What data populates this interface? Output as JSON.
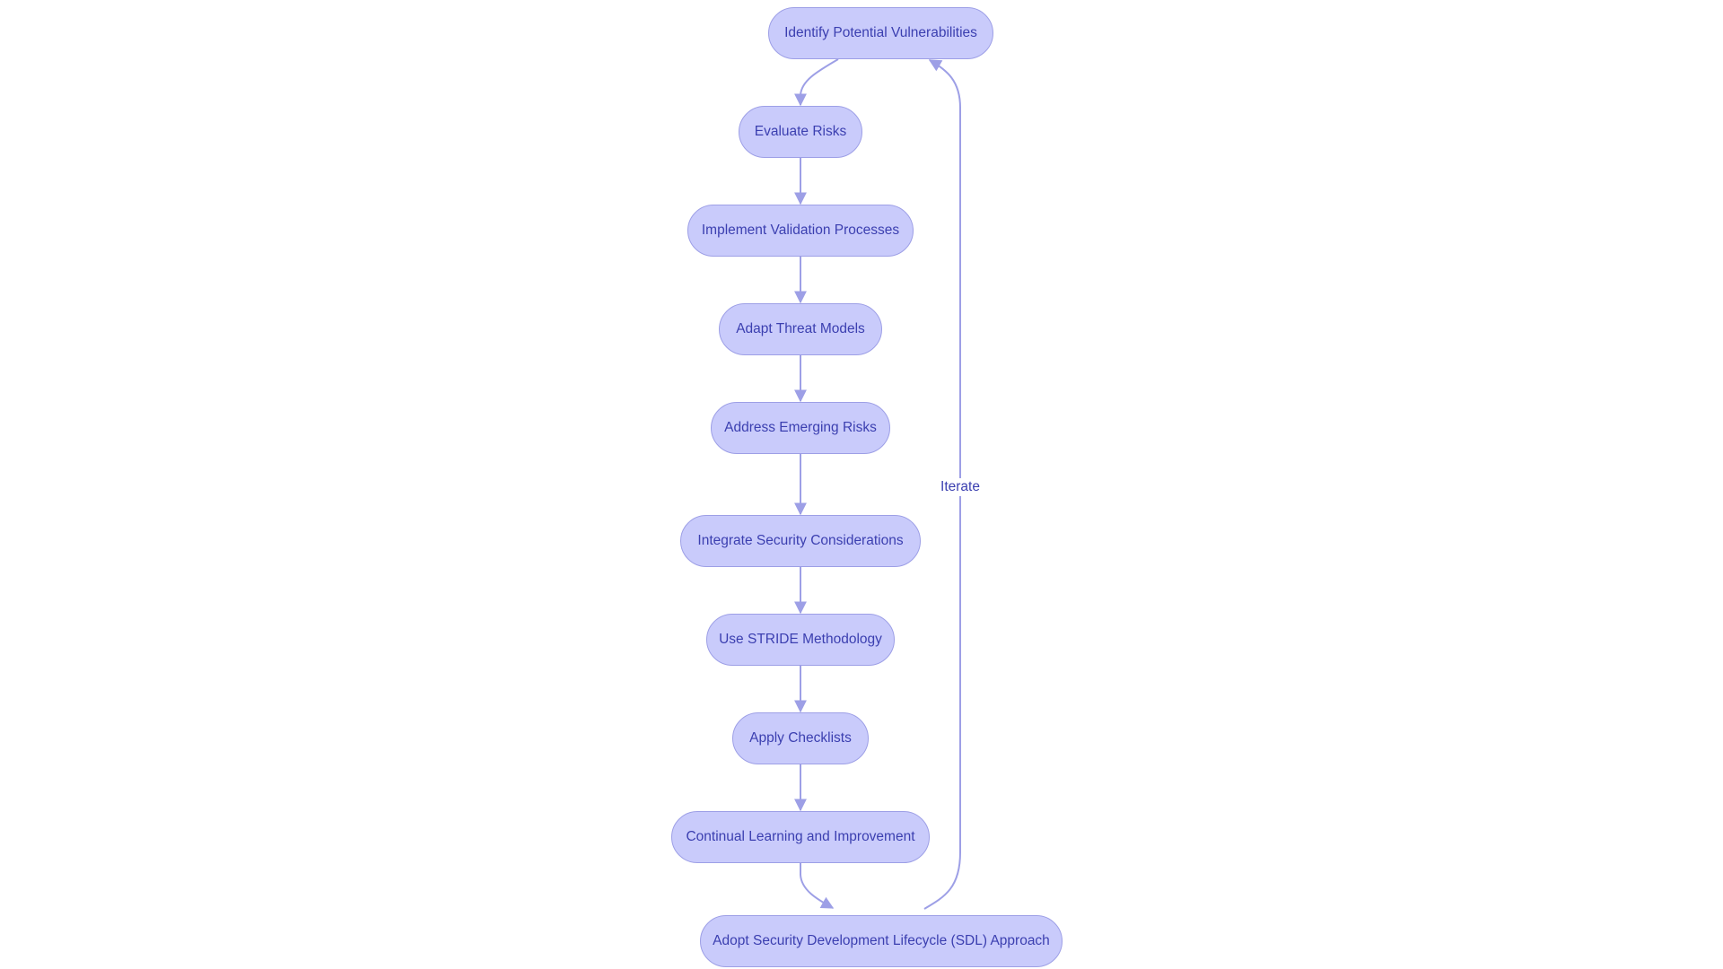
{
  "diagram": {
    "type": "flowchart",
    "direction": "top-to-bottom",
    "colors": {
      "node_fill": "#c9cbfb",
      "node_stroke": "#9d9fe6",
      "node_text": "#3b3fb0",
      "edge": "#9d9fe6"
    },
    "nodes": [
      {
        "id": "n1",
        "label": "Identify Potential Vulnerabilities"
      },
      {
        "id": "n2",
        "label": "Evaluate Risks"
      },
      {
        "id": "n3",
        "label": "Implement Validation Processes"
      },
      {
        "id": "n4",
        "label": "Adapt Threat Models"
      },
      {
        "id": "n5",
        "label": "Address Emerging Risks"
      },
      {
        "id": "n6",
        "label": "Integrate Security Considerations"
      },
      {
        "id": "n7",
        "label": "Use STRIDE Methodology"
      },
      {
        "id": "n8",
        "label": "Apply Checklists"
      },
      {
        "id": "n9",
        "label": "Continual Learning and Improvement"
      },
      {
        "id": "n10",
        "label": "Adopt Security Development Lifecycle (SDL) Approach"
      }
    ],
    "edges": [
      {
        "from": "n1",
        "to": "n2",
        "label": ""
      },
      {
        "from": "n2",
        "to": "n3",
        "label": ""
      },
      {
        "from": "n3",
        "to": "n4",
        "label": ""
      },
      {
        "from": "n4",
        "to": "n5",
        "label": ""
      },
      {
        "from": "n5",
        "to": "n6",
        "label": ""
      },
      {
        "from": "n6",
        "to": "n7",
        "label": ""
      },
      {
        "from": "n7",
        "to": "n8",
        "label": ""
      },
      {
        "from": "n8",
        "to": "n9",
        "label": ""
      },
      {
        "from": "n9",
        "to": "n10",
        "label": ""
      },
      {
        "from": "n10",
        "to": "n1",
        "label": "Iterate"
      }
    ]
  }
}
